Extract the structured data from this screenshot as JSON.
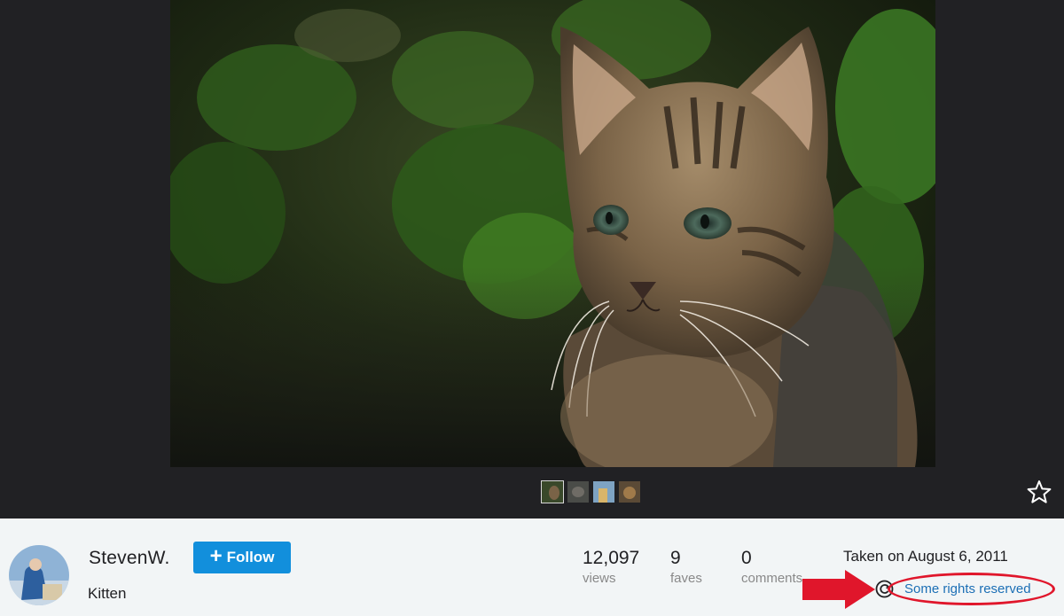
{
  "photo": {
    "title": "Kitten",
    "subject": "tabby kitten in front of green foliage"
  },
  "thumbnails": [
    {
      "name": "thumb-1",
      "active": true
    },
    {
      "name": "thumb-2",
      "active": false
    },
    {
      "name": "thumb-3",
      "active": false
    },
    {
      "name": "thumb-4",
      "active": false
    }
  ],
  "owner": {
    "username": "StevenW.",
    "follow_label": "Follow"
  },
  "stats": {
    "views_count": "12,097",
    "views_label": "views",
    "faves_count": "9",
    "faves_label": "faves",
    "comments_count": "0",
    "comments_label": "comments"
  },
  "meta": {
    "taken_on": "Taken on August 6, 2011",
    "license_link": "Some rights reserved"
  },
  "icons": {
    "favorite": "star-outline-icon",
    "license": "creative-commons-icon",
    "follow_plus": "plus-icon",
    "annotation_arrow": "red-arrow-icon"
  },
  "colors": {
    "viewer_bg": "#212124",
    "infobar_bg": "#f2f5f6",
    "follow_button": "#128fdc",
    "link": "#1c6fb5",
    "annotation": "#e0162b"
  }
}
